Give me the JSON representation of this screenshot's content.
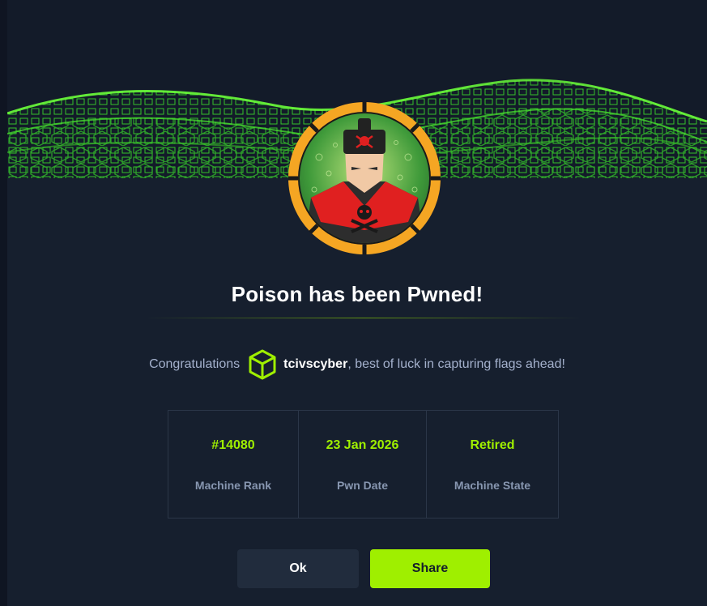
{
  "dialog": {
    "title": "Poison has been Pwned!",
    "congrats_prefix": "Congratulations",
    "username": "tcivscyber",
    "congrats_suffix": ", best of luck in capturing flags ahead!"
  },
  "stats": [
    {
      "value": "#14080",
      "label": "Machine Rank"
    },
    {
      "value": "23 Jan 2026",
      "label": "Pwn Date"
    },
    {
      "value": "Retired",
      "label": "Machine State"
    }
  ],
  "buttons": {
    "ok_label": "Ok",
    "share_label": "Share"
  },
  "icons": {
    "user_badge": "cube-icon",
    "avatar": "machine-avatar-skull"
  },
  "colors": {
    "accent": "#9fef00",
    "background": "#161f2e",
    "avatar_ring": "#f5a623"
  }
}
